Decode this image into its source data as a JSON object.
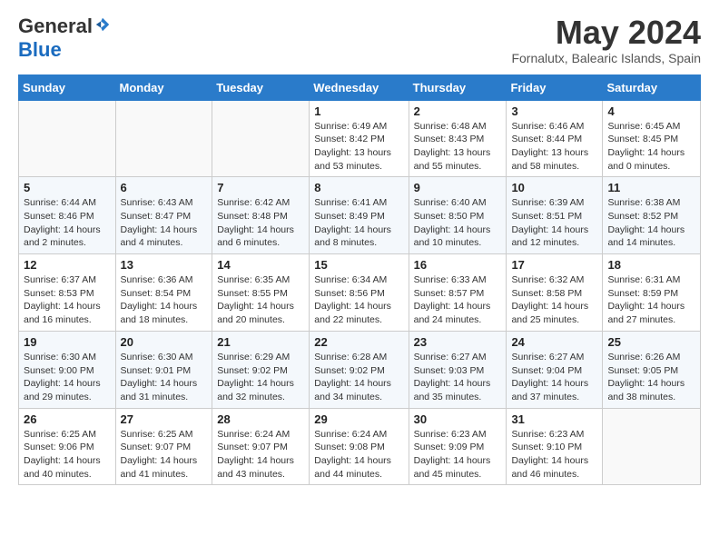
{
  "header": {
    "logo_general": "General",
    "logo_blue": "Blue",
    "month_title": "May 2024",
    "location": "Fornalutx, Balearic Islands, Spain"
  },
  "weekdays": [
    "Sunday",
    "Monday",
    "Tuesday",
    "Wednesday",
    "Thursday",
    "Friday",
    "Saturday"
  ],
  "weeks": [
    [
      {
        "day": "",
        "info": ""
      },
      {
        "day": "",
        "info": ""
      },
      {
        "day": "",
        "info": ""
      },
      {
        "day": "1",
        "info": "Sunrise: 6:49 AM\nSunset: 8:42 PM\nDaylight: 13 hours\nand 53 minutes."
      },
      {
        "day": "2",
        "info": "Sunrise: 6:48 AM\nSunset: 8:43 PM\nDaylight: 13 hours\nand 55 minutes."
      },
      {
        "day": "3",
        "info": "Sunrise: 6:46 AM\nSunset: 8:44 PM\nDaylight: 13 hours\nand 58 minutes."
      },
      {
        "day": "4",
        "info": "Sunrise: 6:45 AM\nSunset: 8:45 PM\nDaylight: 14 hours\nand 0 minutes."
      }
    ],
    [
      {
        "day": "5",
        "info": "Sunrise: 6:44 AM\nSunset: 8:46 PM\nDaylight: 14 hours\nand 2 minutes."
      },
      {
        "day": "6",
        "info": "Sunrise: 6:43 AM\nSunset: 8:47 PM\nDaylight: 14 hours\nand 4 minutes."
      },
      {
        "day": "7",
        "info": "Sunrise: 6:42 AM\nSunset: 8:48 PM\nDaylight: 14 hours\nand 6 minutes."
      },
      {
        "day": "8",
        "info": "Sunrise: 6:41 AM\nSunset: 8:49 PM\nDaylight: 14 hours\nand 8 minutes."
      },
      {
        "day": "9",
        "info": "Sunrise: 6:40 AM\nSunset: 8:50 PM\nDaylight: 14 hours\nand 10 minutes."
      },
      {
        "day": "10",
        "info": "Sunrise: 6:39 AM\nSunset: 8:51 PM\nDaylight: 14 hours\nand 12 minutes."
      },
      {
        "day": "11",
        "info": "Sunrise: 6:38 AM\nSunset: 8:52 PM\nDaylight: 14 hours\nand 14 minutes."
      }
    ],
    [
      {
        "day": "12",
        "info": "Sunrise: 6:37 AM\nSunset: 8:53 PM\nDaylight: 14 hours\nand 16 minutes."
      },
      {
        "day": "13",
        "info": "Sunrise: 6:36 AM\nSunset: 8:54 PM\nDaylight: 14 hours\nand 18 minutes."
      },
      {
        "day": "14",
        "info": "Sunrise: 6:35 AM\nSunset: 8:55 PM\nDaylight: 14 hours\nand 20 minutes."
      },
      {
        "day": "15",
        "info": "Sunrise: 6:34 AM\nSunset: 8:56 PM\nDaylight: 14 hours\nand 22 minutes."
      },
      {
        "day": "16",
        "info": "Sunrise: 6:33 AM\nSunset: 8:57 PM\nDaylight: 14 hours\nand 24 minutes."
      },
      {
        "day": "17",
        "info": "Sunrise: 6:32 AM\nSunset: 8:58 PM\nDaylight: 14 hours\nand 25 minutes."
      },
      {
        "day": "18",
        "info": "Sunrise: 6:31 AM\nSunset: 8:59 PM\nDaylight: 14 hours\nand 27 minutes."
      }
    ],
    [
      {
        "day": "19",
        "info": "Sunrise: 6:30 AM\nSunset: 9:00 PM\nDaylight: 14 hours\nand 29 minutes."
      },
      {
        "day": "20",
        "info": "Sunrise: 6:30 AM\nSunset: 9:01 PM\nDaylight: 14 hours\nand 31 minutes."
      },
      {
        "day": "21",
        "info": "Sunrise: 6:29 AM\nSunset: 9:02 PM\nDaylight: 14 hours\nand 32 minutes."
      },
      {
        "day": "22",
        "info": "Sunrise: 6:28 AM\nSunset: 9:02 PM\nDaylight: 14 hours\nand 34 minutes."
      },
      {
        "day": "23",
        "info": "Sunrise: 6:27 AM\nSunset: 9:03 PM\nDaylight: 14 hours\nand 35 minutes."
      },
      {
        "day": "24",
        "info": "Sunrise: 6:27 AM\nSunset: 9:04 PM\nDaylight: 14 hours\nand 37 minutes."
      },
      {
        "day": "25",
        "info": "Sunrise: 6:26 AM\nSunset: 9:05 PM\nDaylight: 14 hours\nand 38 minutes."
      }
    ],
    [
      {
        "day": "26",
        "info": "Sunrise: 6:25 AM\nSunset: 9:06 PM\nDaylight: 14 hours\nand 40 minutes."
      },
      {
        "day": "27",
        "info": "Sunrise: 6:25 AM\nSunset: 9:07 PM\nDaylight: 14 hours\nand 41 minutes."
      },
      {
        "day": "28",
        "info": "Sunrise: 6:24 AM\nSunset: 9:07 PM\nDaylight: 14 hours\nand 43 minutes."
      },
      {
        "day": "29",
        "info": "Sunrise: 6:24 AM\nSunset: 9:08 PM\nDaylight: 14 hours\nand 44 minutes."
      },
      {
        "day": "30",
        "info": "Sunrise: 6:23 AM\nSunset: 9:09 PM\nDaylight: 14 hours\nand 45 minutes."
      },
      {
        "day": "31",
        "info": "Sunrise: 6:23 AM\nSunset: 9:10 PM\nDaylight: 14 hours\nand 46 minutes."
      },
      {
        "day": "",
        "info": ""
      }
    ]
  ]
}
